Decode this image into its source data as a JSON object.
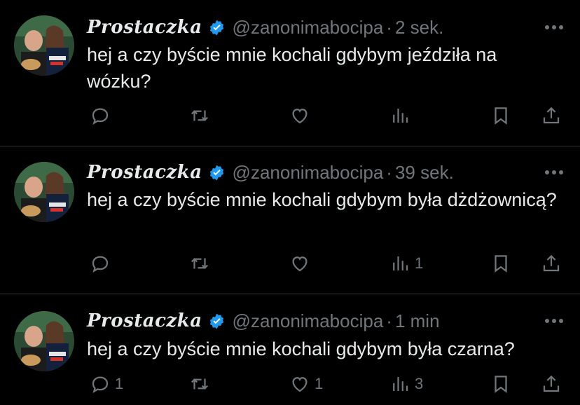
{
  "colors": {
    "background": "#000000",
    "text": "#e7e9ea",
    "muted": "#71767b",
    "verified": "#1d9bf0",
    "divider": "#2f3336"
  },
  "tweets": [
    {
      "display_name": "Prostaczka",
      "handle": "@zanonimabocipa",
      "time": "2 sek.",
      "text": "hej a czy byście mnie kochali gdybym jeździła na wózku?",
      "counts": {
        "reply": "",
        "retweet": "",
        "like": "",
        "views": ""
      }
    },
    {
      "display_name": "Prostaczka",
      "handle": "@zanonimabocipa",
      "time": "39 sek.",
      "text": "hej a czy byście mnie kochali gdybym była dżdżownicą?",
      "counts": {
        "reply": "",
        "retweet": "",
        "like": "",
        "views": "1"
      }
    },
    {
      "display_name": "Prostaczka",
      "handle": "@zanonimabocipa",
      "time": "1 min",
      "text": "hej a czy byście mnie kochali gdybym była czarna?",
      "counts": {
        "reply": "1",
        "retweet": "",
        "like": "1",
        "views": "3"
      }
    }
  ],
  "icons": [
    "more-icon",
    "verified-icon",
    "reply-icon",
    "retweet-icon",
    "like-icon",
    "views-icon",
    "bookmark-icon",
    "share-icon"
  ]
}
